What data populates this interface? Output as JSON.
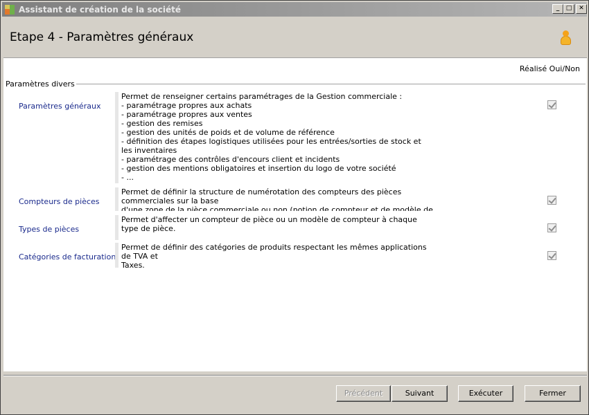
{
  "window": {
    "title": "Assistant de création de la société",
    "min_label": "_",
    "max_label": "□",
    "close_label": "✕"
  },
  "header": {
    "step_title": "Etape 4 - Paramètres généraux",
    "icon": "user-icon"
  },
  "table": {
    "column_header": "Réalisé Oui/Non",
    "group_label": "Paramètres divers"
  },
  "rows": [
    {
      "title": "Paramètres généraux",
      "description": "Permet de renseigner certains paramétrages de la Gestion commerciale :\n- paramétrage propres aux achats\n- paramétrage propres aux ventes\n- gestion des remises\n- gestion des unités de poids et de volume de référence\n- définition des étapes logistiques utilisées pour les entrées/sorties de stock et les inventaires\n- paramétrage des contrôles d'encours client et incidents\n- gestion des mentions obligatoires et insertion du logo de votre société\n- ...",
      "done": true
    },
    {
      "title": "Compteurs de pièces",
      "description": "Permet de définir la structure de numérotation des compteurs des pièces commerciales sur la base\nd'une zone de la pièce commerciale ou non (notion de compteur et de modèle de compteur).",
      "done": true
    },
    {
      "title": "Types de pièces",
      "description": "Permet d'affecter un compteur de pièce ou un modèle de compteur à chaque type de pièce.",
      "done": true
    },
    {
      "title": "Catégories de facturation",
      "description": "Permet de définir des catégories de produits respectant les mêmes applications de TVA et\nTaxes.",
      "done": true
    }
  ],
  "footer": {
    "previous_label": "Précédent",
    "next_label": "Suivant",
    "execute_label": "Exécuter",
    "close_label": "Fermer"
  }
}
